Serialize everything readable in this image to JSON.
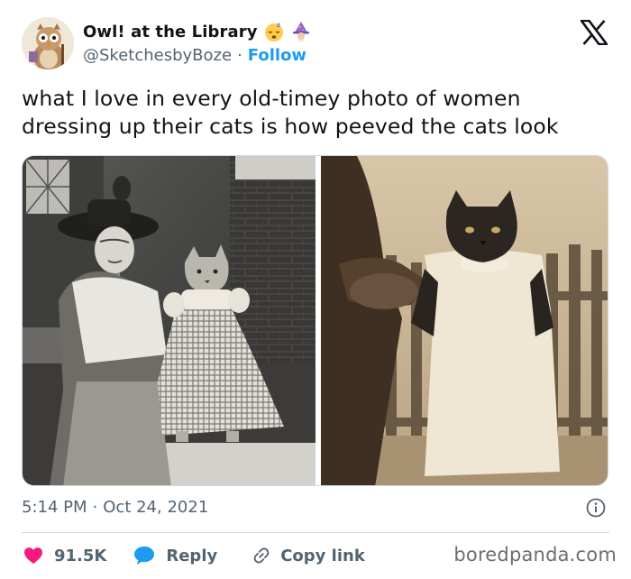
{
  "author": {
    "display_name": "Owl! at the Library",
    "handle": "@SketchesbyBoze",
    "follow_label": "Follow",
    "separator": "·",
    "badges": [
      "sleeping-face-emoji",
      "mage-emoji"
    ]
  },
  "tweet": {
    "text": "what I love in every old-timey photo of women dressing up their cats is how peeved the cats look"
  },
  "meta": {
    "time": "5:14 PM",
    "separator": "·",
    "date": "Oct 24, 2021"
  },
  "actions": {
    "likes": "91.5K",
    "reply_label": "Reply",
    "copy_link_label": "Copy link"
  },
  "watermark": "boredpanda.com",
  "colors": {
    "accent": "#1d9bf0",
    "like": "#f91880",
    "text": "#0f1419",
    "secondary": "#536471",
    "border": "#cfd9de"
  },
  "icons": [
    "x-logo-icon",
    "heart-icon",
    "reply-bubble-icon",
    "link-icon",
    "info-icon"
  ]
}
